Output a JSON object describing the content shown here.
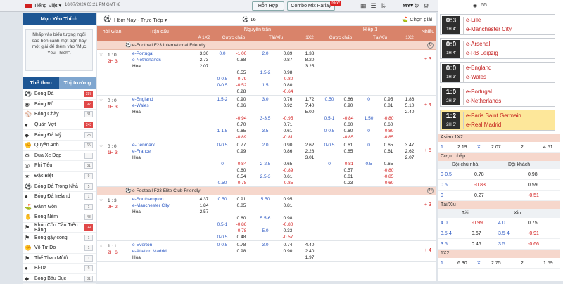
{
  "topbar": {
    "language": "Tiếng Việt",
    "datetime": "10/07/2024 03:21 PM GMT+8",
    "mixed_label": "Hỗn Hợp",
    "combo_label": "Combo Mix Parlay",
    "new_badge": "NEW",
    "odds_type": "MY"
  },
  "sidebar": {
    "favorites_title": "Mục Yêu Thích",
    "favorites_hint": "Nhấp vào biểu tượng ngôi sao bên cạnh một trận hay một giải để thêm vào \"Mục Yêu Thích\".",
    "tabs": [
      "Thể thao",
      "Thị trường"
    ],
    "sports": [
      {
        "name": "Bóng Đá",
        "count": "287",
        "icon": "soccer-icon",
        "highlight": true
      },
      {
        "name": "Bóng Rổ",
        "count": "92",
        "icon": "basketball-icon",
        "highlight": true
      },
      {
        "name": "Bóng Chày",
        "count": "31",
        "icon": "baseball-icon",
        "highlight": false
      },
      {
        "name": "Quần Vợt",
        "count": "243",
        "icon": "tennis-icon",
        "highlight": true
      },
      {
        "name": "Bóng Đá Mỹ",
        "count": "28",
        "icon": "football-icon",
        "highlight": false
      },
      {
        "name": "Quyền Anh",
        "count": "65",
        "icon": "boxing-icon",
        "highlight": false
      },
      {
        "name": "Đua Xe Đạp",
        "count": "",
        "icon": "cycling-icon",
        "highlight": false
      },
      {
        "name": "Phi Tiêu",
        "count": "31",
        "icon": "darts-icon",
        "highlight": false
      },
      {
        "name": "Đặc Biệt",
        "count": "9",
        "icon": "star-icon",
        "highlight": false
      },
      {
        "name": "Bóng Đá Trong Nhà",
        "count": "5",
        "icon": "futsal-icon",
        "highlight": false
      },
      {
        "name": "Bóng Đá Ireland",
        "count": "1",
        "icon": "gaelic-icon",
        "highlight": false
      },
      {
        "name": "Đánh Gôn",
        "count": "1",
        "icon": "golf-icon",
        "highlight": false
      },
      {
        "name": "Bóng Ném",
        "count": "48",
        "icon": "handball-icon",
        "highlight": false
      },
      {
        "name": "Khúc Côn Cầu Trên Băng",
        "count": "144",
        "icon": "hockey-icon",
        "highlight": true
      },
      {
        "name": "Bóng gậy cong",
        "count": "1",
        "icon": "hurling-icon",
        "highlight": false
      },
      {
        "name": "Võ Tự Do",
        "count": "1",
        "icon": "mma-icon",
        "highlight": false
      },
      {
        "name": "Thể Thao Môtô",
        "count": "1",
        "icon": "motorsport-icon",
        "highlight": false
      },
      {
        "name": "Bi-Da",
        "count": "9",
        "icon": "billiards-icon",
        "highlight": false
      },
      {
        "name": "Bóng Bầu Dục",
        "count": "31",
        "icon": "rugby-icon",
        "highlight": false
      }
    ]
  },
  "main": {
    "section_title": "Hôm Nay - Trực Tiếp",
    "match_count": "16",
    "pick_label": "Chọn giải",
    "headers": {
      "time": "Thời Gian",
      "match": "Trận đấu",
      "full_time": "Nguyên trận",
      "half": "Hiệp 1",
      "more": "Nhiều",
      "sub": [
        "A 1X2",
        "Cược chấp",
        "Tài/Xỉu",
        "1X2",
        "Cược chấp",
        "Tài/Xỉu",
        "1X2"
      ]
    },
    "leagues": [
      {
        "name": "e-Football F23 International Friendly",
        "matches": [
          {
            "score": "1 : 0",
            "time": "2H 3'",
            "home": "e-Portugal",
            "away": "e-Netherlands",
            "draw": "Hòa",
            "more": "+ 3",
            "rows": [
              [
                "3.30",
                "0.0",
                "-1.00",
                "2.0",
                "0.89",
                "1.38",
                "",
                "",
                "",
                "",
                "",
                ""
              ],
              [
                "2.73",
                "",
                "0.68",
                "",
                "0.87",
                "8.20",
                "",
                "",
                "",
                "",
                "",
                ""
              ],
              [
                "2.07",
                "",
                "",
                "",
                "",
                "3.25",
                "",
                "",
                "",
                "",
                "",
                ""
              ],
              [
                "",
                "",
                "0.55",
                "1.5-2",
                "0.98",
                "",
                "",
                "",
                "",
                "",
                "",
                ""
              ],
              [
                "",
                "0-0.5",
                "-0.79",
                "",
                "-0.80",
                "",
                "",
                "",
                "",
                "",
                "",
                ""
              ],
              [
                "",
                "0-0.5",
                "-0.52",
                "1.5",
                "0.80",
                "",
                "",
                "",
                "",
                "",
                "",
                ""
              ],
              [
                "",
                "",
                "0.28",
                "",
                "-0.64",
                "",
                "",
                "",
                "",
                "",
                "",
                ""
              ]
            ]
          },
          {
            "score": "0 : 0",
            "time": "1H 3'",
            "home": "e-England",
            "away": "e-Wales",
            "draw": "Hòa",
            "more": "+ 4",
            "rows": [
              [
                "",
                "1.5-2",
                "0.90",
                "3.0",
                "0.76",
                "1.72",
                "0.50",
                "0.86",
                "0",
                "0.95",
                "1.86",
                ""
              ],
              [
                "",
                "",
                "0.86",
                "",
                "0.92",
                "7.40",
                "",
                "0.90",
                "",
                "0.81",
                "5.10",
                ""
              ],
              [
                "",
                "",
                "",
                "",
                "",
                "5.00",
                "",
                "",
                "",
                "",
                "2.40",
                ""
              ],
              [
                "",
                "",
                "-0.94",
                "3-3.5",
                "-0.95",
                "",
                "0.5-1",
                "-0.84",
                "1.50",
                "-0.80",
                "",
                ""
              ],
              [
                "",
                "",
                "0.70",
                "",
                "0.71",
                "",
                "",
                "0.60",
                "",
                "0.60",
                "",
                ""
              ],
              [
                "",
                "1-1.5",
                "0.65",
                "3.5",
                "0.61",
                "",
                "0-0.5",
                "0.60",
                "0",
                "-0.80",
                "",
                ""
              ],
              [
                "",
                "",
                "-0.89",
                "",
                "-0.81",
                "",
                "",
                "-0.85",
                "",
                "-0.85",
                "",
                ""
              ]
            ]
          },
          {
            "score": "0 : 0",
            "time": "1H 3'",
            "home": "e-Denmark",
            "away": "e-France",
            "draw": "Hòa",
            "more": "+ 5",
            "rows": [
              [
                "",
                "0-0.5",
                "0.77",
                "2.0",
                "0.90",
                "2.62",
                "0-0.5",
                "0.61",
                "0",
                "0.65",
                "3.47",
                ""
              ],
              [
                "",
                "",
                "0.99",
                "",
                "0.86",
                "2.28",
                "",
                "0.85",
                "",
                "0.61",
                "2.62",
                ""
              ],
              [
                "",
                "",
                "",
                "",
                "",
                "3.01",
                "",
                "",
                "",
                "",
                "2.07",
                ""
              ],
              [
                "",
                "0",
                "-0.84",
                "2-2.5",
                "0.65",
                "",
                "0",
                "-0.81",
                "0.5",
                "0.65",
                "",
                ""
              ],
              [
                "",
                "",
                "0.60",
                "",
                "-0.89",
                "",
                "",
                "0.57",
                "",
                "-0.80",
                "",
                ""
              ],
              [
                "",
                "",
                "0.54",
                "2.5-3",
                "0.61",
                "",
                "",
                "0.61",
                "",
                "-0.85",
                "",
                ""
              ],
              [
                "",
                "0.50",
                "-0.78",
                "",
                "-0.85",
                "",
                "",
                "0.23",
                "",
                "-0.60",
                "",
                ""
              ]
            ]
          }
        ]
      },
      {
        "name": "e-Football F23 Elite Club Friendly",
        "matches": [
          {
            "score": "1 : 3",
            "time": "2H 2'",
            "home": "e-Southampton",
            "away": "e-Manchester City",
            "draw": "Hòa",
            "more": "+ 3",
            "rows": [
              [
                "4.37",
                "0.50",
                "0.91",
                "5.50",
                "0.95",
                "",
                "",
                "",
                "",
                "",
                "",
                ""
              ],
              [
                "1.84",
                "",
                "0.85",
                "",
                "0.81",
                "",
                "",
                "",
                "",
                "",
                "",
                ""
              ],
              [
                "2.57",
                "",
                "",
                "",
                "",
                "",
                "",
                "",
                "",
                "",
                "",
                ""
              ],
              [
                "",
                "",
                "0.60",
                "5.5-6",
                "0.98",
                "",
                "",
                "",
                "",
                "",
                "",
                ""
              ],
              [
                "",
                "0.5-1",
                "-0.86",
                "",
                "-0.80",
                "",
                "",
                "",
                "",
                "",
                "",
                ""
              ],
              [
                "",
                "",
                "-0.78",
                "5.0",
                "0.33",
                "",
                "",
                "",
                "",
                "",
                "",
                ""
              ],
              [
                "",
                "0-0.5",
                "0.48",
                "",
                "-0.57",
                "",
                "",
                "",
                "",
                "",
                "",
                ""
              ]
            ]
          },
          {
            "score": "1 : 1",
            "time": "2H 6'",
            "home": "e-Everton",
            "away": "e-Atletico Madrid",
            "draw": "Hòa",
            "more": "+ 4",
            "rows": [
              [
                "",
                "0-0.5",
                "0.78",
                "3.0",
                "0.74",
                "4.40",
                "",
                "",
                "",
                "",
                "",
                ""
              ],
              [
                "",
                "",
                "0.98",
                "",
                "0.90",
                "2.40",
                "",
                "",
                "",
                "",
                "",
                ""
              ],
              [
                "",
                "",
                "",
                "",
                "",
                "1.97",
                "",
                "",
                "",
                "",
                "",
                ""
              ]
            ]
          }
        ]
      }
    ]
  },
  "right": {
    "live_count": "55",
    "live_scores": [
      {
        "score": "0:3",
        "time": "1H 4'",
        "home": "e-Lille",
        "away": "e-Manchester City",
        "highlight": false
      },
      {
        "score": "0:0",
        "time": "1H 4'",
        "home": "e-Arsenal",
        "away": "e-RB Leipzig",
        "highlight": false
      },
      {
        "score": "0:0",
        "time": "1H 3'",
        "home": "e-England",
        "away": "e-Wales",
        "highlight": false
      },
      {
        "score": "1:0",
        "time": "2H 3'",
        "home": "e-Portugal",
        "away": "e-Netherlands",
        "highlight": false
      },
      {
        "score": "1:2",
        "time": "2H 5'",
        "home": "e-Paris Saint Germain",
        "away": "e-Real Madrid",
        "highlight": true
      }
    ],
    "asian_title": "Asian 1X2",
    "asian_row": [
      "1",
      "2.19",
      "X",
      "2.07",
      "2",
      "4.51"
    ],
    "handicap_title": "Cược chấp",
    "handicap_home": "Đội chủ nhà",
    "handicap_away": "Đội khách",
    "handicap_rows": [
      [
        "0-0.5",
        "0.78",
        "",
        "0.98"
      ],
      [
        "0.5",
        "-0.83",
        "",
        "0.59"
      ],
      [
        "0",
        "0.27",
        "",
        "-0.51"
      ]
    ],
    "ou_title": "Tài/Xỉu",
    "ou_over": "Tài",
    "ou_under": "Xỉu",
    "ou_rows": [
      [
        "4.0",
        "-0.99",
        "4.0",
        "0.75"
      ],
      [
        "3.5-4",
        "0.67",
        "3.5-4",
        "-0.91"
      ],
      [
        "3.5",
        "0.46",
        "3.5",
        "-0.66"
      ]
    ],
    "x12_title": "1X2",
    "x12_row": [
      "1",
      "6.30",
      "X",
      "2.75",
      "2",
      "1.59"
    ],
    "colors": {
      "accent": "#1d5694",
      "header": "#d9836a",
      "league": "#f6d7cc",
      "negative": "#d21a1a",
      "highlight": "#fde79a"
    }
  }
}
